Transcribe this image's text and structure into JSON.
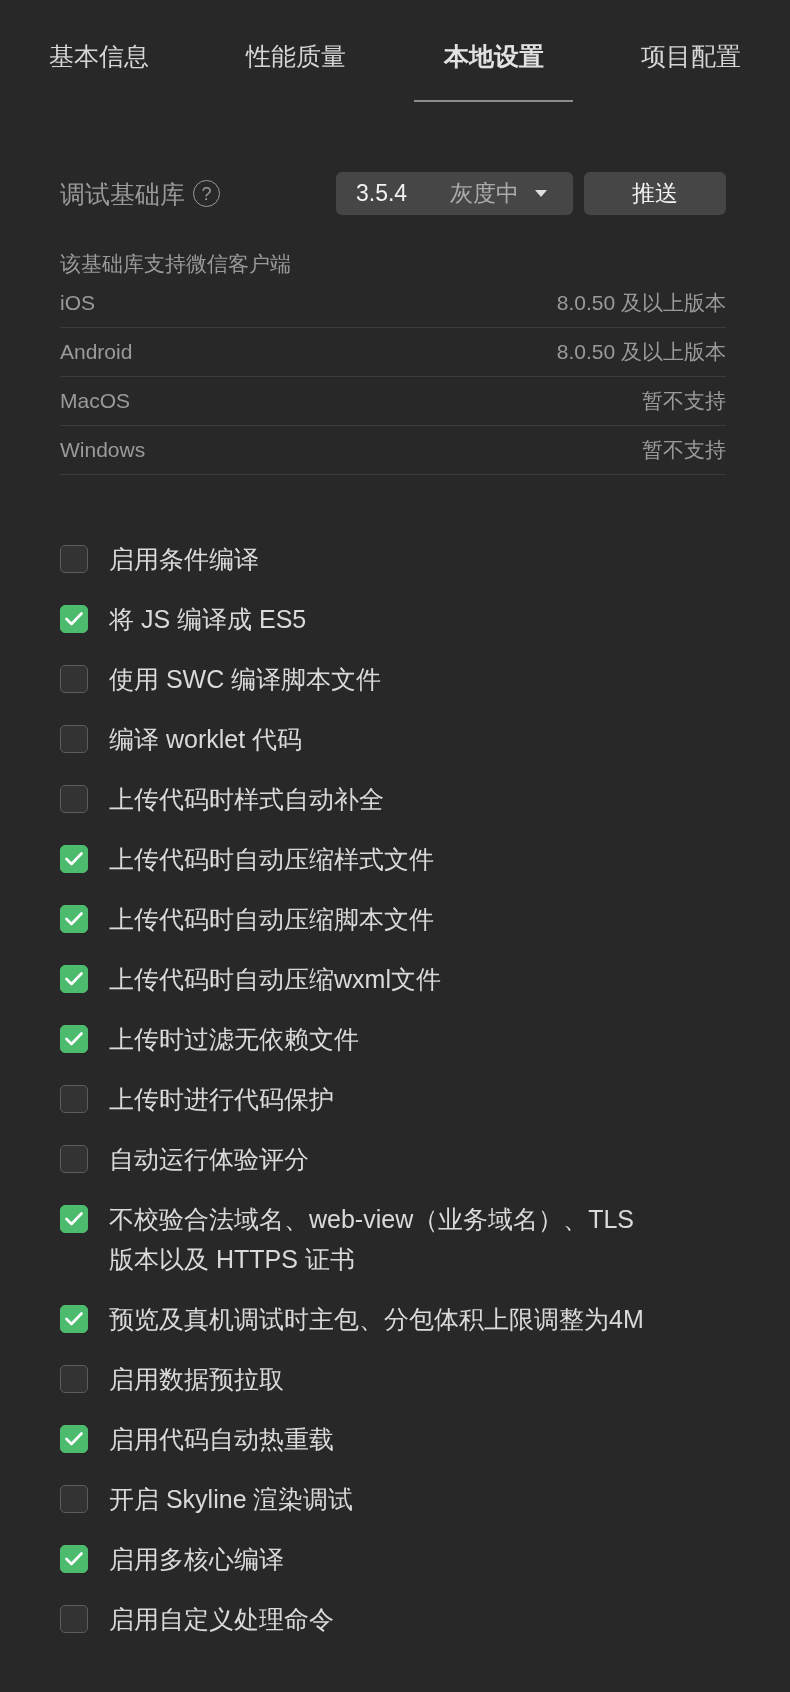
{
  "tabs": [
    {
      "label": "基本信息",
      "selected": false
    },
    {
      "label": "性能质量",
      "selected": false
    },
    {
      "label": "本地设置",
      "selected": true
    },
    {
      "label": "项目配置",
      "selected": false
    }
  ],
  "base_library": {
    "label": "调试基础库",
    "help": "?",
    "version_select": {
      "version": "3.5.4",
      "stage": "灰度中"
    },
    "push_button": "推送"
  },
  "client_support": {
    "title": "该基础库支持微信客户端",
    "rows": [
      {
        "platform": "iOS",
        "requirement": "8.0.50 及以上版本"
      },
      {
        "platform": "Android",
        "requirement": "8.0.50 及以上版本"
      },
      {
        "platform": "MacOS",
        "requirement": "暂不支持"
      },
      {
        "platform": "Windows",
        "requirement": "暂不支持"
      }
    ]
  },
  "options": [
    {
      "label": "启用条件编译",
      "checked": false
    },
    {
      "label": "将 JS 编译成 ES5",
      "checked": true
    },
    {
      "label": "使用 SWC 编译脚本文件",
      "checked": false
    },
    {
      "label": "编译 worklet 代码",
      "checked": false
    },
    {
      "label": "上传代码时样式自动补全",
      "checked": false
    },
    {
      "label": "上传代码时自动压缩样式文件",
      "checked": true
    },
    {
      "label": "上传代码时自动压缩脚本文件",
      "checked": true
    },
    {
      "label": "上传代码时自动压缩wxml文件",
      "checked": true
    },
    {
      "label": "上传时过滤无依赖文件",
      "checked": true
    },
    {
      "label": "上传时进行代码保护",
      "checked": false
    },
    {
      "label": "自动运行体验评分",
      "checked": false
    },
    {
      "label": "不校验合法域名、web-view（业务域名）、TLS 版本以及 HTTPS 证书",
      "checked": true
    },
    {
      "label": "预览及真机调试时主包、分包体积上限调整为4M",
      "checked": true
    },
    {
      "label": "启用数据预拉取",
      "checked": false
    },
    {
      "label": "启用代码自动热重载",
      "checked": true
    },
    {
      "label": "开启 Skyline 渲染调试",
      "checked": false
    },
    {
      "label": "启用多核心编译",
      "checked": true
    },
    {
      "label": "启用自定义处理命令",
      "checked": false
    }
  ]
}
